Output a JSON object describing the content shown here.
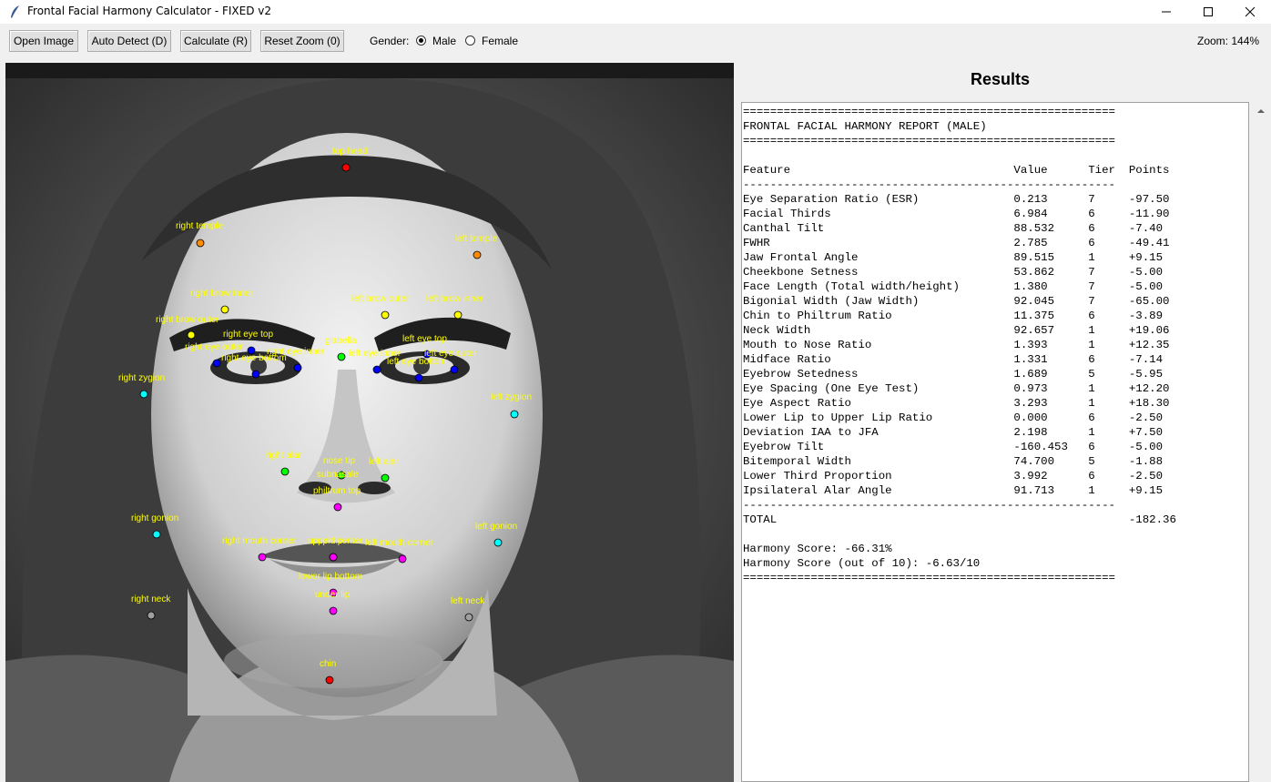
{
  "window": {
    "title": "Frontal Facial Harmony Calculator - FIXED v2"
  },
  "toolbar": {
    "open_image": "Open Image",
    "auto_detect": "Auto Detect (D)",
    "calculate": "Calculate (R)",
    "reset_zoom": "Reset Zoom (0)",
    "gender_label": "Gender:",
    "gender_options": [
      "Male",
      "Female"
    ],
    "gender_selected": "Male",
    "zoom_label": "Zoom: 144%"
  },
  "results": {
    "heading": "Results",
    "report": "=======================================================\nFRONTAL FACIAL HARMONY REPORT (MALE)\n=======================================================\n\nFeature                                 Value      Tier  Points\n-------------------------------------------------------\nEye Separation Ratio (ESR)              0.213      7     -97.50\nFacial Thirds                           6.984      6     -11.90\nCanthal Tilt                            88.532     6     -7.40\nFWHR                                    2.785      6     -49.41\nJaw Frontal Angle                       89.515     1     +9.15\nCheekbone Setness                       53.862     7     -5.00\nFace Length (Total width/height)        1.380      7     -5.00\nBigonial Width (Jaw Width)              92.045     7     -65.00\nChin to Philtrum Ratio                  11.375     6     -3.89\nNeck Width                              92.657     1     +19.06\nMouth to Nose Ratio                     1.393      1     +12.35\nMidface Ratio                           1.331      6     -7.14\nEyebrow Setedness                       1.689      5     -5.95\nEye Spacing (One Eye Test)              0.973      1     +12.20\nEye Aspect Ratio                        3.293      1     +18.30\nLower Lip to Upper Lip Ratio            0.000      6     -2.50\nDeviation IAA to JFA                    2.198      1     +7.50\nEyebrow Tilt                            -160.453   6     -5.00\nBitemporal Width                        74.700     5     -1.88\nLower Third Proportion                  3.992      6     -2.50\nIpsilateral Alar Angle                  91.713     1     +9.15\n-------------------------------------------------------\nTOTAL                                                    -182.36\n\nHarmony Score: -66.31%\nHarmony Score (out of 10): -6.63/10\n======================================================="
  },
  "landmarks": [
    {
      "label": "top head",
      "color": "#ff0000"
    },
    {
      "label": "right temple",
      "color": "#ff8c00"
    },
    {
      "label": "left temple",
      "color": "#ff8c00"
    },
    {
      "label": "right brow inner",
      "color": "#ffff00"
    },
    {
      "label": "right brow outer",
      "color": "#ffff00"
    },
    {
      "label": "left brow outer",
      "color": "#ffff00"
    },
    {
      "label": "left brow inner",
      "color": "#ffff00"
    },
    {
      "label": "right eye top",
      "color": "#0000ff"
    },
    {
      "label": "right eye outer",
      "color": "#0000ff"
    },
    {
      "label": "right eye bottom",
      "color": "#0000ff"
    },
    {
      "label": "right eye inner",
      "color": "#0000ff"
    },
    {
      "label": "glabella",
      "color": "#00ff00"
    },
    {
      "label": "left eye top",
      "color": "#0000ff"
    },
    {
      "label": "left eye inner",
      "color": "#0000ff"
    },
    {
      "label": "left eye outer",
      "color": "#0000ff"
    },
    {
      "label": "left eye bottom",
      "color": "#0000ff"
    },
    {
      "label": "right zygion",
      "color": "#00ffff"
    },
    {
      "label": "left zygion",
      "color": "#00ffff"
    },
    {
      "label": "right alar",
      "color": "#00ff00"
    },
    {
      "label": "nose tip",
      "color": "#00ff00"
    },
    {
      "label": "subnasale",
      "color": "#00ff00"
    },
    {
      "label": "left alar",
      "color": "#00ff00"
    },
    {
      "label": "philtrum top",
      "color": "#ff00ff"
    },
    {
      "label": "right gonion",
      "color": "#00ffff"
    },
    {
      "label": "left gonion",
      "color": "#00ffff"
    },
    {
      "label": "right mouth corner",
      "color": "#ff00ff"
    },
    {
      "label": "upper lip",
      "color": "#ff00ff"
    },
    {
      "label": "cupid center",
      "color": "#ff00ff"
    },
    {
      "label": "left mouth corner",
      "color": "#ff00ff"
    },
    {
      "label": "lower lip bottom",
      "color": "#ff00ff"
    },
    {
      "label": "under lip",
      "color": "#ff00ff"
    },
    {
      "label": "right neck",
      "color": "#a0a0a0"
    },
    {
      "label": "left neck",
      "color": "#a0a0a0"
    },
    {
      "label": "chin",
      "color": "#ff0000"
    }
  ]
}
